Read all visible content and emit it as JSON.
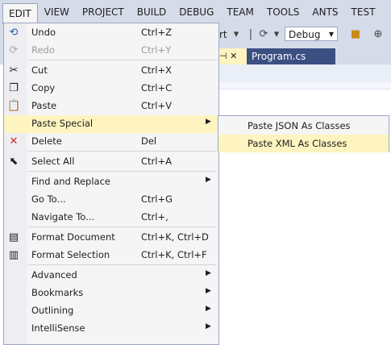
{
  "menubar": [
    "EDIT",
    "VIEW",
    "PROJECT",
    "BUILD",
    "DEBUG",
    "TEAM",
    "TOOLS",
    "ANTS",
    "TEST"
  ],
  "toolbar": {
    "frag": "rt",
    "config": "Debug"
  },
  "tabs": {
    "prev_tab_glyph": "⊣ ✕",
    "active_tab": "Program.cs"
  },
  "menu": {
    "items": [
      {
        "label": "Undo",
        "shortcut": "Ctrl+Z",
        "icon": "undo-icon"
      },
      {
        "label": "Redo",
        "shortcut": "Ctrl+Y",
        "icon": "redo-icon",
        "disabled": true
      },
      {
        "label": "Cut",
        "shortcut": "Ctrl+X",
        "icon": "cut-icon"
      },
      {
        "label": "Copy",
        "shortcut": "Ctrl+C",
        "icon": "copy-icon"
      },
      {
        "label": "Paste",
        "shortcut": "Ctrl+V",
        "icon": "paste-icon"
      },
      {
        "label": "Paste Special",
        "shortcut": "",
        "submenu": true,
        "highlighted": true
      },
      {
        "label": "Delete",
        "shortcut": "Del",
        "icon": "delete-icon"
      },
      {
        "label": "Select All",
        "shortcut": "Ctrl+A",
        "icon": "select-all-icon"
      },
      {
        "label": "Find and Replace",
        "shortcut": "",
        "submenu": true
      },
      {
        "label": "Go To...",
        "shortcut": "Ctrl+G"
      },
      {
        "label": "Navigate To...",
        "shortcut": "Ctrl+,"
      },
      {
        "label": "Format Document",
        "shortcut": "Ctrl+K, Ctrl+D",
        "icon": "format-document-icon"
      },
      {
        "label": "Format Selection",
        "shortcut": "Ctrl+K, Ctrl+F",
        "icon": "format-selection-icon"
      },
      {
        "label": "Advanced",
        "shortcut": "",
        "submenu": true
      },
      {
        "label": "Bookmarks",
        "shortcut": "",
        "submenu": true
      },
      {
        "label": "Outlining",
        "shortcut": "",
        "submenu": true
      },
      {
        "label": "IntelliSense",
        "shortcut": "",
        "submenu": true
      }
    ]
  },
  "submenu": {
    "items": [
      {
        "label": "Paste JSON As Classes"
      },
      {
        "label": "Paste XML As Classes",
        "highlighted": true
      }
    ]
  },
  "colors": {
    "menubar": "#d6dbe9",
    "highlight": "#fdf4bf",
    "active_tab": "#3b4f81"
  }
}
